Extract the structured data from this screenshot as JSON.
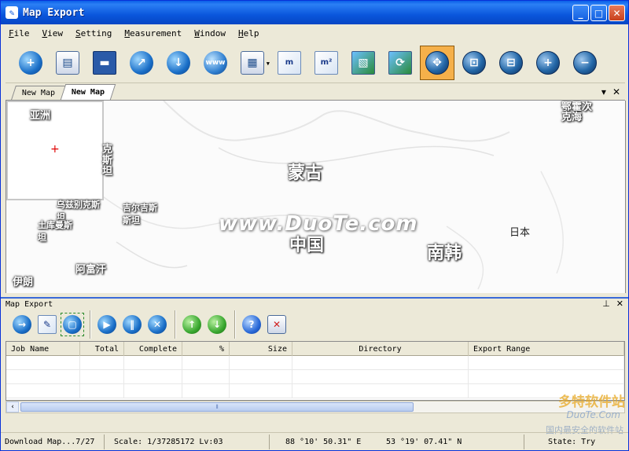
{
  "window": {
    "title": "Map Export"
  },
  "menu": [
    "File",
    "View",
    "Setting",
    "Measurement",
    "Window",
    "Help"
  ],
  "toolbar": {
    "buttons": [
      {
        "name": "add-task",
        "glyph": "+"
      },
      {
        "name": "open-file",
        "glyph": "▤"
      },
      {
        "name": "save",
        "glyph": "▬"
      },
      {
        "name": "export",
        "glyph": "↗"
      },
      {
        "name": "download",
        "glyph": "↓"
      },
      {
        "name": "www",
        "glyph": "www"
      },
      {
        "name": "layers-dropdown",
        "glyph": "▦"
      },
      {
        "name": "measure-distance",
        "glyph": "m"
      },
      {
        "name": "measure-area",
        "glyph": "m²"
      },
      {
        "name": "image-view",
        "glyph": "▧"
      },
      {
        "name": "refresh-view",
        "glyph": "⟳"
      },
      {
        "name": "pan",
        "glyph": "✥"
      },
      {
        "name": "zoom-extent",
        "glyph": "⊡"
      },
      {
        "name": "zoom-window",
        "glyph": "⊟"
      },
      {
        "name": "zoom-in",
        "glyph": "+"
      },
      {
        "name": "zoom-out",
        "glyph": "−"
      }
    ]
  },
  "map_tabs": [
    "New Map",
    "New Map"
  ],
  "map": {
    "labels": {
      "asia": "亚洲",
      "mongolia": "蒙古",
      "china": "中国",
      "south_korea": "南韩",
      "japan": "日本",
      "kyrgyzstan": "吉尔吉斯斯坦",
      "kazakhstan_part": "克斯坦",
      "uzbekistan": "乌兹别克斯坦",
      "turkmenistan": "土库曼斯坦",
      "afghanistan": "阿富汗",
      "iran": "伊朗",
      "okhotsk": "鄂霍次克海"
    },
    "watermark": "www.DuoTe.com"
  },
  "panel": {
    "title": "Map Export",
    "buttons": [
      "start-job",
      "edit-job",
      "job-range",
      "resume-job",
      "pause-job",
      "delete-job",
      "move-up",
      "move-down",
      "help",
      "clear-list"
    ],
    "columns": [
      "Job Name",
      "Total",
      "Complete",
      "%",
      "Size",
      "Directory",
      "Export Range"
    ]
  },
  "status": {
    "download": "Download Map...7/27",
    "scale": "Scale: 1/37285172 Lv:03",
    "lon": "88 °10' 50.31\"  E",
    "lat": "53 °19' 07.41\"  N",
    "state": "State:  Try"
  },
  "site_watermark": {
    "brand": "多特软件站",
    "domain": "DuoTe.Com",
    "slogan": "国内最安全的软件站"
  }
}
